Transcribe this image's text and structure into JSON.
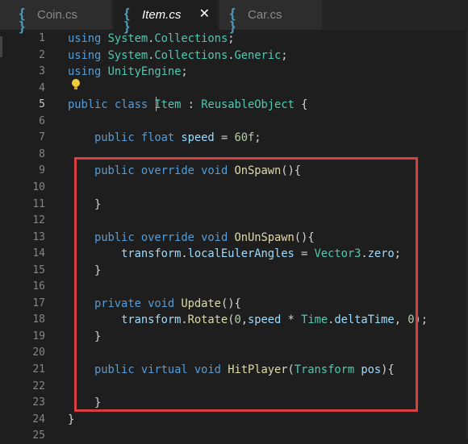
{
  "tabs": [
    {
      "label": "Coin.cs",
      "icon": "csharp-file-icon",
      "active": false
    },
    {
      "label": "Item.cs",
      "icon": "csharp-file-icon",
      "active": true,
      "close_glyph": "✕"
    },
    {
      "label": "Car.cs",
      "icon": "csharp-file-icon",
      "active": false
    }
  ],
  "editor": {
    "active_line": 5,
    "highlighted_lines": [
      9,
      23
    ],
    "colors": {
      "keyword": "#569cd6",
      "type": "#4ec9b0",
      "number": "#b5cea8",
      "function": "#dcdcaa",
      "highlight_border": "#d93f3f"
    },
    "lines": [
      {
        "n": "1",
        "code": "using System.Collections;"
      },
      {
        "n": "2",
        "code": "using System.Collections.Generic;"
      },
      {
        "n": "3",
        "code": "using UnityEngine;"
      },
      {
        "n": "4",
        "code": ""
      },
      {
        "n": "5",
        "code": "public class Item : ReusableObject {"
      },
      {
        "n": "6",
        "code": ""
      },
      {
        "n": "7",
        "code": "    public float speed = 60f;"
      },
      {
        "n": "8",
        "code": ""
      },
      {
        "n": "9",
        "code": "    public override void OnSpawn(){"
      },
      {
        "n": "10",
        "code": ""
      },
      {
        "n": "11",
        "code": "    }"
      },
      {
        "n": "12",
        "code": ""
      },
      {
        "n": "13",
        "code": "    public override void OnUnSpawn(){"
      },
      {
        "n": "14",
        "code": "        transform.localEulerAngles = Vector3.zero;"
      },
      {
        "n": "15",
        "code": "    }"
      },
      {
        "n": "16",
        "code": ""
      },
      {
        "n": "17",
        "code": "    private void Update(){"
      },
      {
        "n": "18",
        "code": "        transform.Rotate(0,speed * Time.deltaTime, 0);"
      },
      {
        "n": "19",
        "code": "    }"
      },
      {
        "n": "20",
        "code": ""
      },
      {
        "n": "21",
        "code": "    public virtual void HitPlayer(Transform pos){"
      },
      {
        "n": "22",
        "code": ""
      },
      {
        "n": "23",
        "code": "    }"
      },
      {
        "n": "24",
        "code": "}"
      },
      {
        "n": "25",
        "code": ""
      }
    ]
  }
}
